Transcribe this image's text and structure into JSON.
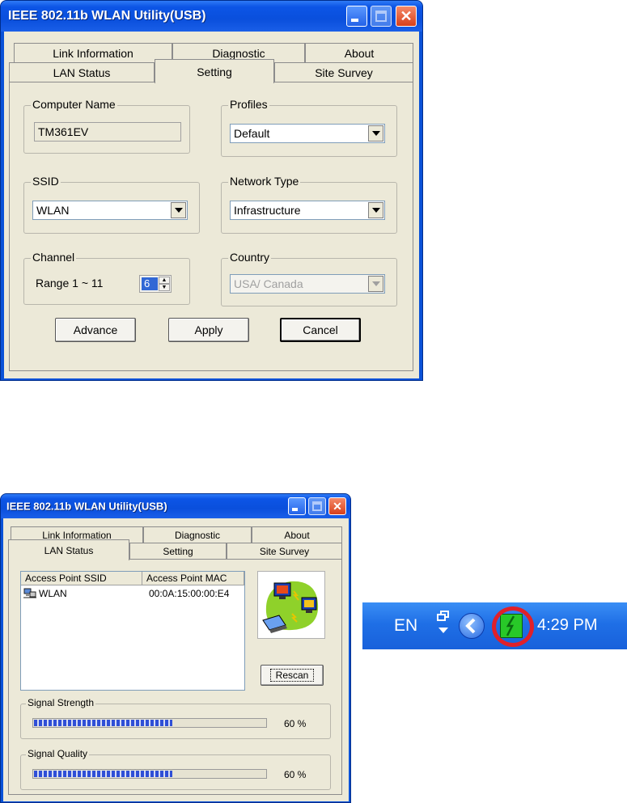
{
  "window_title": "IEEE 802.11b WLAN Utility(USB)",
  "tabs": {
    "row_back": [
      "Link Information",
      "Diagnostic",
      "About"
    ],
    "row_front": [
      "LAN Status",
      "Setting",
      "Site Survey"
    ]
  },
  "setting": {
    "computer_name": {
      "label": "Computer Name",
      "value": "TM361EV"
    },
    "profiles": {
      "label": "Profiles",
      "value": "Default"
    },
    "ssid": {
      "label": "SSID",
      "value": "WLAN"
    },
    "network_type": {
      "label": "Network Type",
      "value": "Infrastructure"
    },
    "channel": {
      "label": "Channel",
      "range": "Range 1 ~ 11",
      "value": "6"
    },
    "country": {
      "label": "Country",
      "value": "USA/ Canada"
    },
    "buttons": {
      "advance": "Advance",
      "apply": "Apply",
      "cancel": "Cancel"
    }
  },
  "lan_status": {
    "columns": [
      "Access Point SSID",
      "Access Point MAC"
    ],
    "rows": [
      {
        "ssid": "WLAN",
        "mac": "00:0A:15:00:00:E4"
      }
    ],
    "rescan": "Rescan",
    "signal_strength": {
      "label": "Signal Strength",
      "percent_text": "60 %",
      "level": 0.6
    },
    "signal_quality": {
      "label": "Signal Quality",
      "percent_text": "60 %",
      "level": 0.6
    }
  },
  "taskbar": {
    "language": "EN",
    "time": "4:29 PM"
  },
  "colors": {
    "title_blue": "#0a52d8",
    "dialog_bg": "#ece9d8",
    "close_red": "#d8401b",
    "tray_highlight": "#e0202a",
    "tray_icon_green": "#28c828"
  },
  "icons": [
    "minimize-icon",
    "maximize-icon",
    "close-icon",
    "computer-network-icon",
    "network-computers-icon",
    "chevron-left-icon",
    "wlan-tray-icon",
    "restore-windows-icon"
  ]
}
